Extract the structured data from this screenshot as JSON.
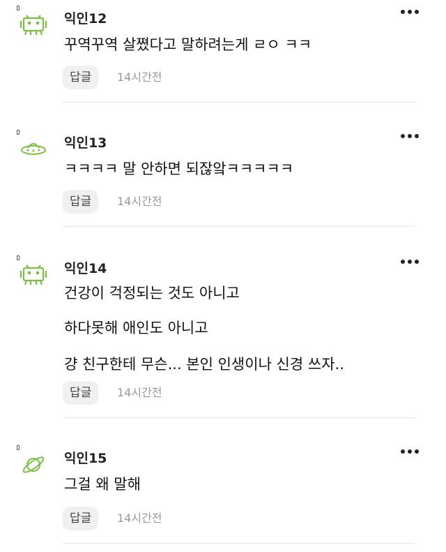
{
  "comments": [
    {
      "author": "익인12",
      "avatar_icon": "space-invader-icon",
      "lines": [
        "꾸역꾸역 살쪘다고 말하려는게 ㄹㅇ ㅋㅋ"
      ],
      "reply_label": "답글",
      "time": "14시간전"
    },
    {
      "author": "익인13",
      "avatar_icon": "ufo-icon",
      "lines": [
        "ㅋㅋㅋㅋ 말 안하면 되잖앜ㅋㅋㅋㅋㅋ"
      ],
      "reply_label": "답글",
      "time": "14시간전"
    },
    {
      "author": "익인14",
      "avatar_icon": "space-invader-icon",
      "lines": [
        "건강이 걱정되는 것도 아니고",
        "하다못해 애인도 아니고",
        "걍 친구한테 무슨... 본인 인생이나 신경 쓰자.."
      ],
      "reply_label": "답글",
      "time": "14시간전"
    },
    {
      "author": "익인15",
      "avatar_icon": "planet-icon",
      "lines": [
        "그걸 왜 말해"
      ],
      "reply_label": "답글",
      "time": "14시간전"
    }
  ],
  "colors": {
    "avatar_green": "#7ac143",
    "divider": "#e6e6e6",
    "reply_bg": "#f0f0f0",
    "time_text": "#999999"
  }
}
